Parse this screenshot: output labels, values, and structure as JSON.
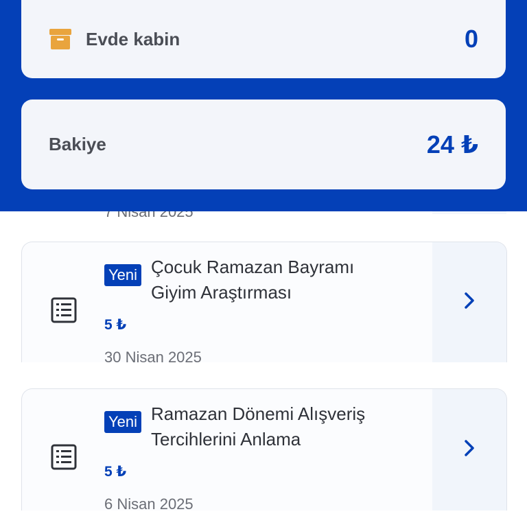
{
  "stats": {
    "home_cabin": {
      "label": "Evde kabin",
      "value": "0",
      "icon": "archive-box-icon"
    },
    "balance": {
      "label": "Bakiye",
      "value": "24 ₺"
    }
  },
  "peek": {
    "date": "7 Nisan 2025"
  },
  "surveys": [
    {
      "badge": "Yeni",
      "title_line1": "Çocuk Ramazan Bayramı",
      "title_line2": "Giyim Araştırması",
      "reward": "5 ₺",
      "date": "30 Nisan 2025",
      "icon": "survey-list-icon"
    },
    {
      "badge": "Yeni",
      "title_line1": "Ramazan Dönemi Alışveriş",
      "title_line2": "Tercihlerini Anlama",
      "reward": "5 ₺",
      "date": "6 Nisan 2025",
      "icon": "survey-list-icon"
    }
  ],
  "colors": {
    "brand_blue": "#0440b7",
    "card_bg": "#f3f5fa",
    "box_orange": "#e9a43d"
  }
}
